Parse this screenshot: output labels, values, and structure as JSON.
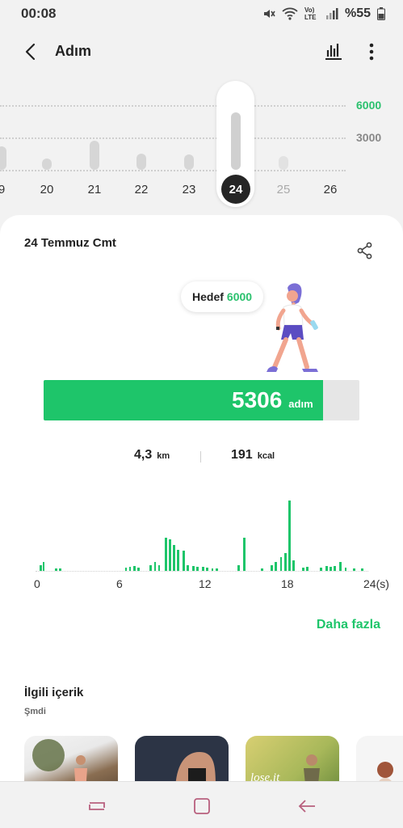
{
  "status": {
    "time": "00:08",
    "lte_label": "Vo) LTE",
    "battery": "%55"
  },
  "appbar": {
    "title": "Adım"
  },
  "daily_chart": {
    "grid": [
      {
        "label": "6000",
        "color": "#2bc16e"
      },
      {
        "label": "3000",
        "color": "#888888"
      }
    ],
    "days": [
      {
        "label": "9",
        "value": 2200
      },
      {
        "label": "20",
        "value": 900
      },
      {
        "label": "21",
        "value": 2700
      },
      {
        "label": "22",
        "value": 1500
      },
      {
        "label": "23",
        "value": 1400
      },
      {
        "label": "24",
        "value": 5306,
        "selected": true
      },
      {
        "label": "25",
        "value": 1300,
        "faded": true
      },
      {
        "label": "26",
        "value": 0
      }
    ]
  },
  "summary": {
    "date": "24 Temmuz Cmt",
    "goal_label": "Hedef",
    "goal_value": "6000",
    "steps_value": "5306",
    "steps_unit": "adım",
    "progress": 0.884,
    "distance_value": "4,3",
    "distance_unit": "km",
    "calories_value": "191",
    "calories_unit": "kcal"
  },
  "hourly": {
    "tick_labels": [
      "0",
      "6",
      "12",
      "18",
      "24(s)"
    ],
    "values_per_slot": [
      3,
      5,
      0,
      0,
      0,
      0,
      2,
      2,
      0,
      0,
      0,
      0,
      0,
      0,
      0,
      0,
      0,
      0,
      0,
      0,
      0,
      0,
      0,
      0,
      0,
      0,
      0,
      0,
      0,
      0,
      0,
      0,
      0,
      0,
      0,
      0,
      0,
      0,
      0,
      0,
      0,
      0,
      0,
      0,
      0,
      0,
      0,
      0,
      0,
      0,
      0,
      0,
      0,
      0,
      0,
      0,
      0,
      0,
      0,
      0,
      0,
      0,
      0,
      0,
      0,
      0,
      0,
      0,
      0,
      0,
      0,
      0,
      0,
      0,
      0,
      0,
      0,
      0,
      0,
      0,
      0,
      0,
      0,
      0,
      0,
      0,
      0,
      0,
      0,
      0,
      0,
      0,
      0,
      0,
      0,
      0,
      0,
      0,
      0,
      0,
      0,
      0,
      0,
      0,
      0,
      0,
      0,
      0,
      0,
      0,
      0,
      0,
      0,
      0,
      0,
      0,
      0,
      0,
      0,
      0,
      0,
      0,
      0,
      0,
      0,
      0,
      0,
      0,
      0,
      0,
      0,
      0,
      0,
      0,
      0,
      0,
      0,
      0,
      0,
      0,
      0,
      0,
      0,
      0,
      0,
      0,
      0,
      0,
      0,
      0,
      0,
      0,
      0,
      0,
      0,
      0,
      0,
      0,
      0,
      0,
      0,
      0,
      0,
      0,
      0,
      0,
      0,
      0,
      0,
      0,
      0,
      0,
      0,
      0,
      0,
      0,
      0,
      0,
      0,
      0,
      0,
      0,
      0,
      0,
      0,
      0,
      0,
      0,
      0,
      0
    ],
    "bars": [
      [
        0.2,
        8
      ],
      [
        0.4,
        12
      ],
      [
        1.3,
        3
      ],
      [
        1.6,
        3
      ],
      [
        6.4,
        4
      ],
      [
        6.7,
        5
      ],
      [
        7.0,
        6
      ],
      [
        7.3,
        4
      ],
      [
        8.2,
        8
      ],
      [
        8.5,
        12
      ],
      [
        8.8,
        8
      ],
      [
        9.3,
        45
      ],
      [
        9.6,
        42
      ],
      [
        9.9,
        35
      ],
      [
        10.2,
        28
      ],
      [
        10.6,
        27
      ],
      [
        10.9,
        8
      ],
      [
        11.3,
        6
      ],
      [
        11.6,
        5
      ],
      [
        12.0,
        5
      ],
      [
        12.3,
        4
      ],
      [
        12.7,
        3
      ],
      [
        13.0,
        3
      ],
      [
        14.6,
        8
      ],
      [
        15.0,
        45
      ],
      [
        16.3,
        3
      ],
      [
        17.0,
        8
      ],
      [
        17.3,
        12
      ],
      [
        17.7,
        18
      ],
      [
        18.0,
        24
      ],
      [
        18.3,
        95
      ],
      [
        18.6,
        14
      ],
      [
        19.3,
        4
      ],
      [
        19.6,
        5
      ],
      [
        20.6,
        4
      ],
      [
        21.0,
        6
      ],
      [
        21.3,
        5
      ],
      [
        21.6,
        7
      ],
      [
        22.0,
        12
      ],
      [
        22.4,
        4
      ],
      [
        23.0,
        3
      ],
      [
        23.6,
        3
      ]
    ]
  },
  "more_link": "Daha fazla",
  "related": {
    "title": "İlgili içerik",
    "subtitle": "Şmdi"
  }
}
